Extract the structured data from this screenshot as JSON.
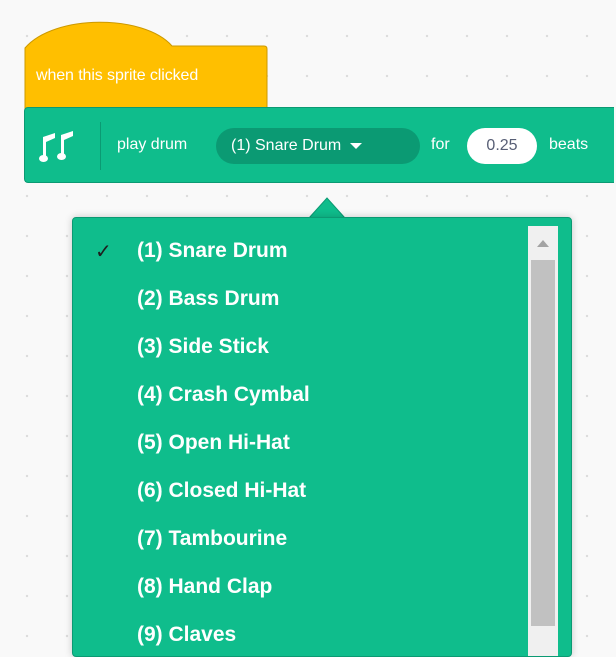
{
  "hat_block": {
    "label": "when this sprite clicked",
    "color": "#ffbf00"
  },
  "sound_block": {
    "icon": "music-notes-icon",
    "play_drum_label": "play drum",
    "drum_selected": "(1) Snare Drum",
    "for_label": "for",
    "beats_value": "0.25",
    "beats_label": "beats",
    "color": "#0fbd8c"
  },
  "dropdown": {
    "checkmark": "✓",
    "items": [
      {
        "label": "(1) Snare Drum",
        "selected": true
      },
      {
        "label": "(2) Bass Drum",
        "selected": false
      },
      {
        "label": "(3) Side Stick",
        "selected": false
      },
      {
        "label": "(4) Crash Cymbal",
        "selected": false
      },
      {
        "label": "(5) Open Hi-Hat",
        "selected": false
      },
      {
        "label": "(6) Closed Hi-Hat",
        "selected": false
      },
      {
        "label": "(7) Tambourine",
        "selected": false
      },
      {
        "label": "(8) Hand Clap",
        "selected": false
      },
      {
        "label": "(9) Claves",
        "selected": false
      }
    ]
  }
}
